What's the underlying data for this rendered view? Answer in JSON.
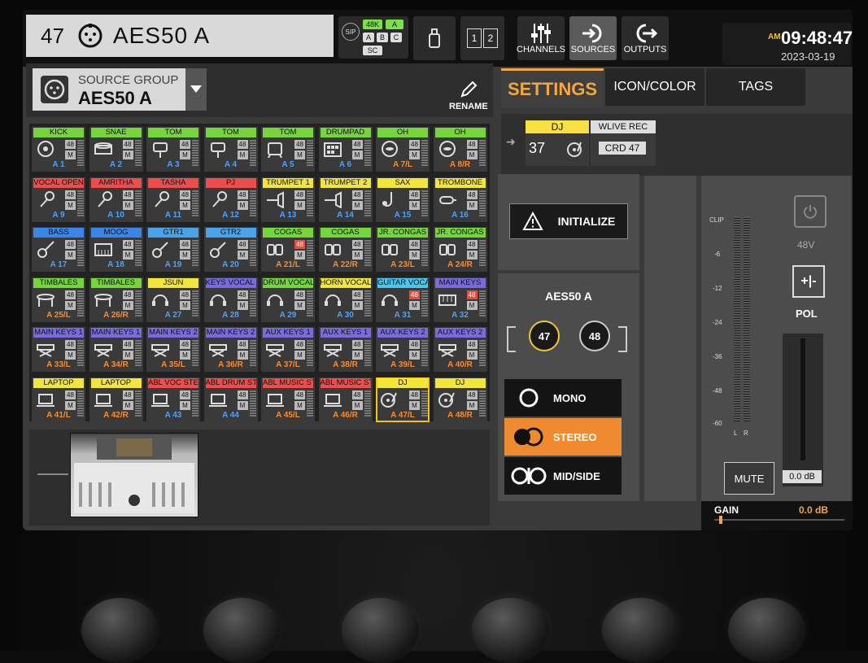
{
  "header": {
    "channel_number": "47",
    "channel_name": "AES50 A",
    "sip": {
      "label": "SIP",
      "rate": "48K",
      "a_top": "A",
      "a": "A",
      "b": "B",
      "c": "C",
      "sc": "SC"
    },
    "page_buttons": {
      "pages_label_1": "1",
      "pages_label_2": "2"
    },
    "nav": {
      "channels": "CHANNELS",
      "sources": "SOURCES",
      "outputs": "OUTPUTS"
    },
    "clock": {
      "ampm": "AM",
      "time": "09:48:47",
      "date": "2023-03-19"
    }
  },
  "source_group": {
    "label": "SOURCE GROUP",
    "value": "AES50 A",
    "rename": "RENAME"
  },
  "tabs": {
    "settings": "SETTINGS",
    "icon_color": "ICON/COLOR",
    "tags": "TAGS"
  },
  "selected_source": {
    "name": "DJ",
    "number": "37",
    "wlive": "WLIVE REC",
    "crd": "CRD 47"
  },
  "initialize": {
    "label": "INITIALIZE"
  },
  "mode": {
    "title": "AES50 A",
    "ch_left": "47",
    "ch_right": "48",
    "mono": "MONO",
    "stereo": "STEREO",
    "midside": "MID/SIDE"
  },
  "meter": {
    "clip": "CLIP",
    "ticks": [
      "-6",
      "-12",
      "-24",
      "-36",
      "-48",
      "-60"
    ],
    "l": "L",
    "r": "R"
  },
  "phantom": {
    "label": "48V"
  },
  "polarity": {
    "label": "POL",
    "glyph": "+|-"
  },
  "fader": {
    "value": "0.0 dB"
  },
  "mute": {
    "label": "MUTE"
  },
  "gain": {
    "label": "GAIN",
    "value": "0.0 dB"
  },
  "tiles": [
    {
      "name": "KICK",
      "color": "#74d63a",
      "src": "A 1",
      "icon": "kick-drum-icon",
      "badge": "48",
      "red": false,
      "stereo": false
    },
    {
      "name": "SNAE",
      "color": "#74d63a",
      "src": "A 2",
      "icon": "snare-drum-icon",
      "badge": "48",
      "red": false,
      "stereo": false
    },
    {
      "name": "TOM",
      "color": "#74d63a",
      "src": "A 3",
      "icon": "tom-drum-icon",
      "badge": "48",
      "red": false,
      "stereo": false
    },
    {
      "name": "TOM",
      "color": "#74d63a",
      "src": "A 4",
      "icon": "tom-drum-icon",
      "badge": "48",
      "red": false,
      "stereo": false
    },
    {
      "name": "TOM",
      "color": "#74d63a",
      "src": "A 5",
      "icon": "floor-tom-icon",
      "badge": "48",
      "red": false,
      "stereo": false
    },
    {
      "name": "DRUMPAD",
      "color": "#74d63a",
      "src": "A 6",
      "icon": "drumpad-icon",
      "badge": "48",
      "red": false,
      "stereo": false
    },
    {
      "name": "OH",
      "color": "#74d63a",
      "src": "A 7/L",
      "icon": "cymbal-icon",
      "badge": "48",
      "red": false,
      "stereo": true
    },
    {
      "name": "OH",
      "color": "#74d63a",
      "src": "A 8/R",
      "icon": "cymbal-icon",
      "badge": "48",
      "red": false,
      "stereo": true
    },
    {
      "name": "VOCAL OPEN",
      "color": "#ee4d4d",
      "src": "A 9",
      "icon": "microphone-icon",
      "badge": "48",
      "red": false,
      "stereo": false
    },
    {
      "name": "AMRITHA",
      "color": "#ee4d4d",
      "src": "A 10",
      "icon": "microphone-icon",
      "badge": "48",
      "red": false,
      "stereo": false
    },
    {
      "name": "TASHA",
      "color": "#ee4d4d",
      "src": "A 11",
      "icon": "microphone-icon",
      "badge": "48",
      "red": false,
      "stereo": false
    },
    {
      "name": "PJ",
      "color": "#ee4d4d",
      "src": "A 12",
      "icon": "microphone-icon",
      "badge": "48",
      "red": false,
      "stereo": false
    },
    {
      "name": "TRUMPET 1",
      "color": "#f2e63a",
      "src": "A 13",
      "icon": "trumpet-icon",
      "badge": "48",
      "red": false,
      "stereo": false
    },
    {
      "name": "TRUMPET 2",
      "color": "#f2e63a",
      "src": "A 14",
      "icon": "trumpet-icon",
      "badge": "48",
      "red": false,
      "stereo": false
    },
    {
      "name": "SAX",
      "color": "#f2e63a",
      "src": "A 15",
      "icon": "saxophone-icon",
      "badge": "48",
      "red": false,
      "stereo": false
    },
    {
      "name": "TROMBONE",
      "color": "#f2e63a",
      "src": "A 16",
      "icon": "trombone-icon",
      "badge": "48",
      "red": false,
      "stereo": false
    },
    {
      "name": "BASS",
      "color": "#3a86e8",
      "src": "A 17",
      "icon": "bass-guitar-icon",
      "badge": "48",
      "red": false,
      "stereo": false
    },
    {
      "name": "MOOG",
      "color": "#3a86e8",
      "src": "A 18",
      "icon": "synth-icon",
      "badge": "48",
      "red": false,
      "stereo": false
    },
    {
      "name": "GTR1",
      "color": "#4aa3e8",
      "src": "A 19",
      "icon": "guitar-icon",
      "badge": "48",
      "red": false,
      "stereo": false
    },
    {
      "name": "GTR2",
      "color": "#4aa3e8",
      "src": "A 20",
      "icon": "guitar-icon",
      "badge": "48",
      "red": false,
      "stereo": false
    },
    {
      "name": "COGAS",
      "color": "#74d63a",
      "src": "A 21/L",
      "icon": "congas-icon",
      "badge": "48",
      "red": true,
      "stereo": true
    },
    {
      "name": "COGAS",
      "color": "#74d63a",
      "src": "A 22/R",
      "icon": "congas-icon",
      "badge": "48",
      "red": false,
      "stereo": true
    },
    {
      "name": "JR. CONGAS",
      "color": "#74d63a",
      "src": "A 23/L",
      "icon": "congas-icon",
      "badge": "48",
      "red": false,
      "stereo": true
    },
    {
      "name": "JR. CONGAS",
      "color": "#74d63a",
      "src": "A 24/R",
      "icon": "congas-icon",
      "badge": "48",
      "red": false,
      "stereo": true
    },
    {
      "name": "TIMBALES",
      "color": "#74d63a",
      "src": "A 25/L",
      "icon": "timbales-icon",
      "badge": "48",
      "red": false,
      "stereo": true
    },
    {
      "name": "TIMBALES",
      "color": "#74d63a",
      "src": "A 26/R",
      "icon": "timbales-icon",
      "badge": "48",
      "red": false,
      "stereo": true
    },
    {
      "name": "JSUN",
      "color": "#f2e63a",
      "src": "A 27",
      "icon": "headset-icon",
      "badge": "48",
      "red": false,
      "stereo": false
    },
    {
      "name": "KEYS VOCAL M",
      "color": "#7a6ae0",
      "src": "A 28",
      "icon": "headset-icon",
      "badge": "48",
      "red": false,
      "stereo": false
    },
    {
      "name": "DRUM VOCAL M",
      "color": "#74d63a",
      "src": "A 29",
      "icon": "headset-icon",
      "badge": "48",
      "red": false,
      "stereo": false
    },
    {
      "name": "HORN VOCAL M",
      "color": "#f2e63a",
      "src": "A 30",
      "icon": "headset-icon",
      "badge": "48",
      "red": false,
      "stereo": false
    },
    {
      "name": "GUITAR VOCAL",
      "color": "#4ac7ef",
      "src": "A 31",
      "icon": "headset-icon",
      "badge": "48",
      "red": true,
      "stereo": false
    },
    {
      "name": "MAIN KEYS",
      "color": "#7a6ae0",
      "src": "A 32",
      "icon": "keyboard-icon",
      "badge": "48",
      "red": true,
      "stereo": false
    },
    {
      "name": "MAIN KEYS 1",
      "color": "#7a6ae0",
      "src": "A 33/L",
      "icon": "keyboard-stand-icon",
      "badge": "48",
      "red": false,
      "stereo": true
    },
    {
      "name": "MAIN KEYS 1",
      "color": "#7a6ae0",
      "src": "A 34/R",
      "icon": "keyboard-stand-icon",
      "badge": "48",
      "red": false,
      "stereo": true
    },
    {
      "name": "MAIN KEYS 2",
      "color": "#7a6ae0",
      "src": "A 35/L",
      "icon": "keyboard-stand-icon",
      "badge": "48",
      "red": false,
      "stereo": true
    },
    {
      "name": "MAIN KEYS 2",
      "color": "#7a6ae0",
      "src": "A 36/R",
      "icon": "keyboard-stand-icon",
      "badge": "48",
      "red": false,
      "stereo": true
    },
    {
      "name": "AUX KEYS 1",
      "color": "#7a6ae0",
      "src": "A 37/L",
      "icon": "keyboard-stand-icon",
      "badge": "48",
      "red": false,
      "stereo": true
    },
    {
      "name": "AUX KEYS 1",
      "color": "#7a6ae0",
      "src": "A 38/R",
      "icon": "keyboard-stand-icon",
      "badge": "48",
      "red": false,
      "stereo": true
    },
    {
      "name": "AUX KEYS 2",
      "color": "#7a6ae0",
      "src": "A 39/L",
      "icon": "keyboard-stand-icon",
      "badge": "48",
      "red": false,
      "stereo": true
    },
    {
      "name": "AUX KEYS 2",
      "color": "#7a6ae0",
      "src": "A 40/R",
      "icon": "keyboard-stand-icon",
      "badge": "48",
      "red": false,
      "stereo": true
    },
    {
      "name": "LAPTOP",
      "color": "#f2e63a",
      "src": "A 41/L",
      "icon": "laptop-icon",
      "badge": "48",
      "red": false,
      "stereo": true
    },
    {
      "name": "LAPTOP",
      "color": "#f2e63a",
      "src": "A 42/R",
      "icon": "laptop-icon",
      "badge": "48",
      "red": false,
      "stereo": true
    },
    {
      "name": "ABL VOC STEM",
      "color": "#ee4d4d",
      "src": "A 43",
      "icon": "laptop-icon",
      "badge": "48",
      "red": false,
      "stereo": false
    },
    {
      "name": "ABL DRUM STE",
      "color": "#ee4d4d",
      "src": "A 44",
      "icon": "laptop-icon",
      "badge": "48",
      "red": false,
      "stereo": false
    },
    {
      "name": "ABL MUSIC ST",
      "color": "#ee4d4d",
      "src": "A 45/L",
      "icon": "laptop-icon",
      "badge": "48",
      "red": false,
      "stereo": true
    },
    {
      "name": "ABL MUSIC ST",
      "color": "#ee4d4d",
      "src": "A 46/R",
      "icon": "laptop-icon",
      "badge": "48",
      "red": false,
      "stereo": true
    },
    {
      "name": "DJ",
      "color": "#f2e63a",
      "src": "A 47/L",
      "icon": "turntable-icon",
      "badge": "48",
      "red": false,
      "stereo": true,
      "selected": true
    },
    {
      "name": "DJ",
      "color": "#f2e63a",
      "src": "A 48/R",
      "icon": "turntable-icon",
      "badge": "48",
      "red": false,
      "stereo": true
    }
  ]
}
